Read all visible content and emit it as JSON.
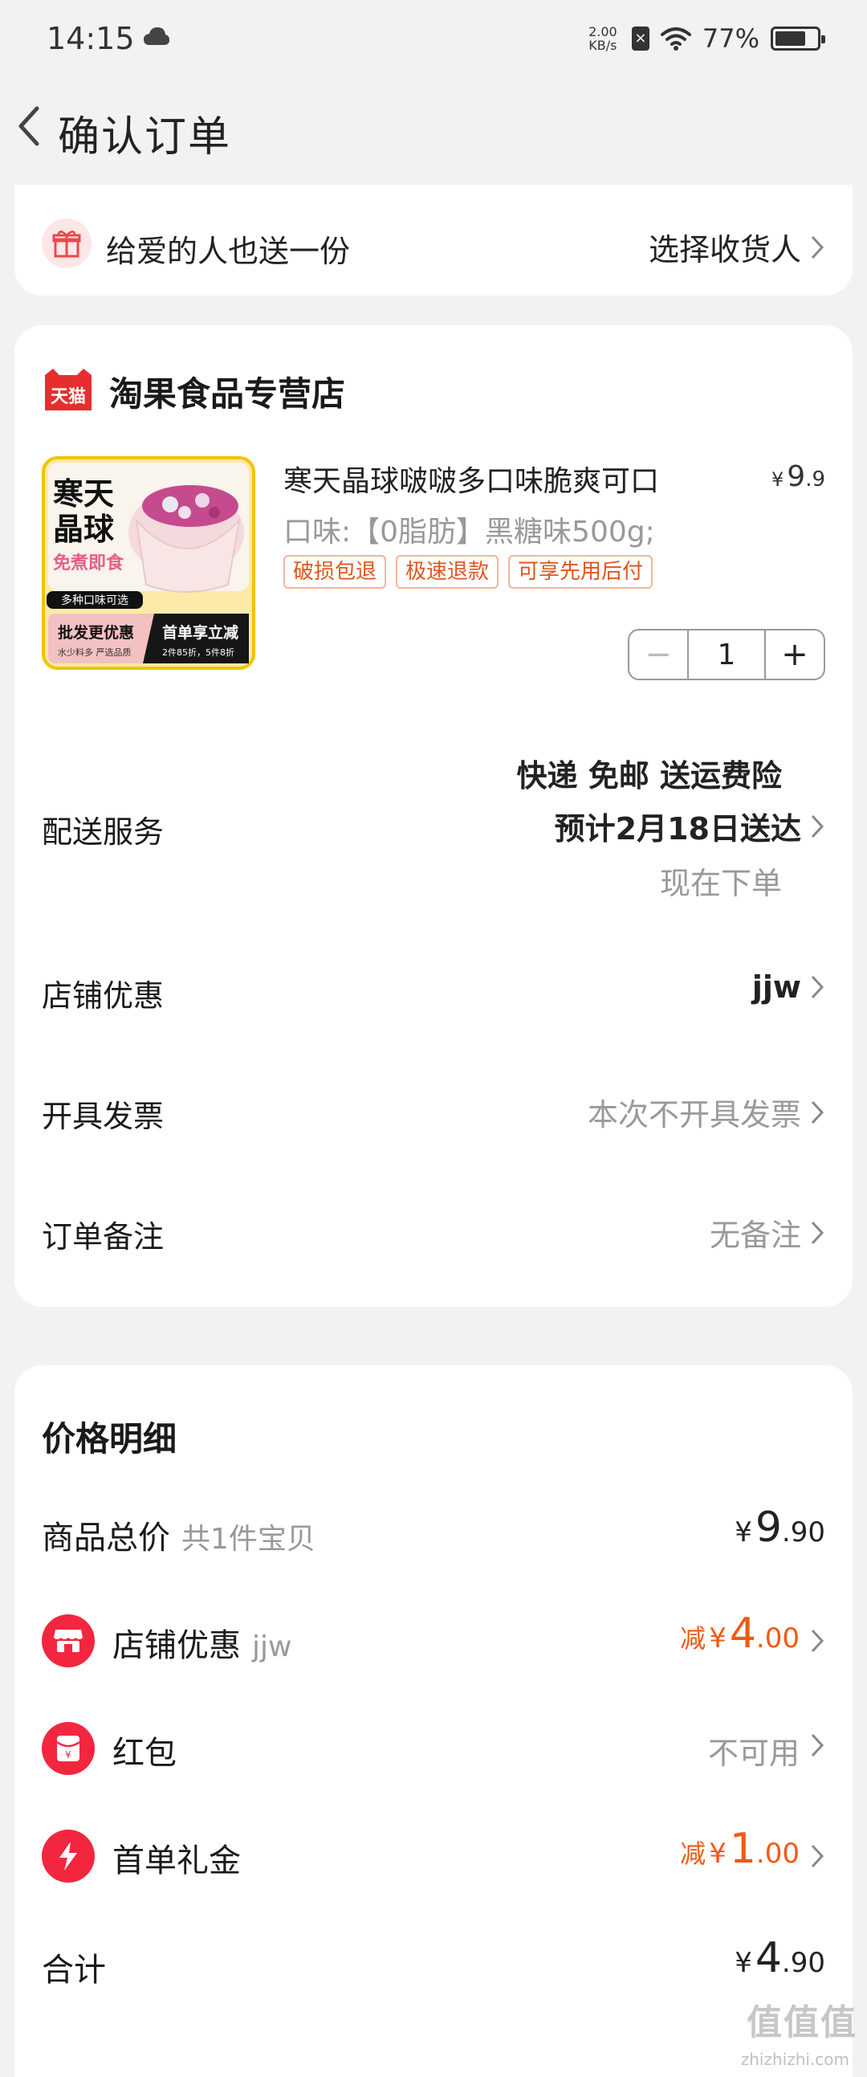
{
  "status_bar": {
    "time": "14:15",
    "net_speed_value": "2.00",
    "net_speed_unit": "KB/s",
    "battery_pct": "77%",
    "battery_level": 0.77
  },
  "nav": {
    "title": "确认订单"
  },
  "gift": {
    "text": "给爱的人也送一份",
    "action": "选择收货人"
  },
  "shop": {
    "logo_text": "天猫",
    "name": "淘果食品专营店",
    "product": {
      "image_text": {
        "line1": "寒天",
        "line2": "晶球",
        "sub": "免煮即食",
        "badge": "多种口味可选",
        "left_title": "批发更优惠",
        "left_sub": "水少料多 严选品质",
        "right_title": "首单享立减",
        "right_sub": "2件85折，5件8折"
      },
      "title": "寒天晶球啵啵多口味脆爽可口",
      "price_symbol": "¥",
      "price_int": "9",
      "price_dec": ".9",
      "variant": "口味:【0脂肪】黑糖味500g;",
      "tags": [
        "破损包退",
        "极速退款",
        "可享先用后付"
      ],
      "quantity": "1",
      "minus": "−",
      "plus": "+"
    },
    "delivery": {
      "label": "配送服务",
      "line1": "快递 免邮 送运费险",
      "line2": "预计2月18日送达",
      "line3": "现在下单"
    },
    "shop_discount": {
      "label": "店铺优惠",
      "value": "jjw"
    },
    "invoice": {
      "label": "开具发票",
      "value": "本次不开具发票"
    },
    "remark": {
      "label": "订单备注",
      "value": "无备注"
    }
  },
  "price_detail": {
    "title": "价格明细",
    "goods_total": {
      "label": "商品总价",
      "sub": "共1件宝贝",
      "yen": "¥",
      "int": "9",
      "dec": ".90"
    },
    "shop_discount": {
      "label": "店铺优惠",
      "sub": "jjw",
      "prefix": "减",
      "yen": "¥",
      "int": "4",
      "dec": ".00"
    },
    "red_packet": {
      "label": "红包",
      "value": "不可用"
    },
    "first_order": {
      "label": "首单礼金",
      "prefix": "减",
      "yen": "¥",
      "int": "1",
      "dec": ".00"
    },
    "total": {
      "label": "合计",
      "yen": "¥",
      "int": "4",
      "dec": ".90"
    }
  },
  "watermark": {
    "main": "值值值",
    "sub": "zhizhizhi.com"
  },
  "colors": {
    "accent_orange": "#f05a13",
    "tmall_red": "#e62e2e",
    "icon_red": "#f2263f"
  }
}
